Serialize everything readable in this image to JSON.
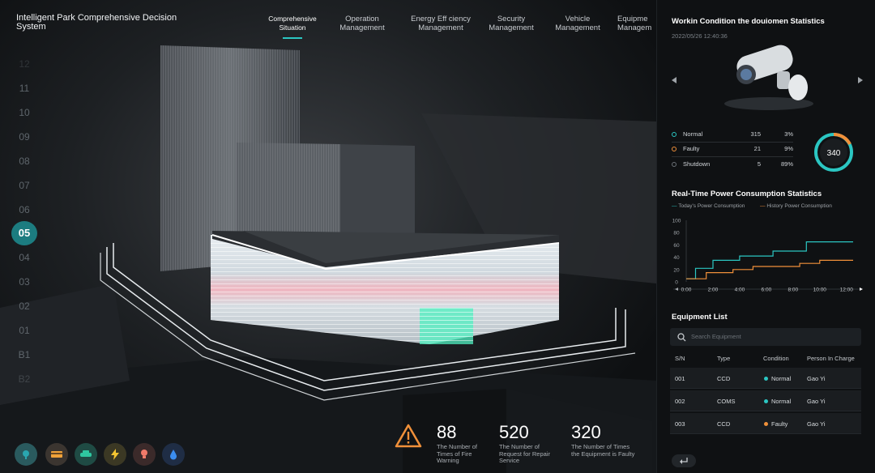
{
  "brand": "Intelligent Park Comprehensive Decision System",
  "nav": [
    {
      "label": "Comprehensive\nSituation",
      "active": true
    },
    {
      "label": "Operation\nManagement"
    },
    {
      "label": "Energy Eff ciency\nManagement"
    },
    {
      "label": "Security\nManagement"
    },
    {
      "label": "Vehicle\nManagement"
    },
    {
      "label": "Equipme\nManagem"
    }
  ],
  "floors": [
    "12",
    "11",
    "10",
    "09",
    "08",
    "07",
    "06",
    "05",
    "04",
    "03",
    "02",
    "01",
    "B1",
    "B2"
  ],
  "active_floor": "05",
  "tools": [
    {
      "icon": "location-pin-icon",
      "color": "#2aa7b0"
    },
    {
      "icon": "card-icon",
      "color": "#f0a23a"
    },
    {
      "icon": "car-icon",
      "color": "#2fc7a0"
    },
    {
      "icon": "lightning-icon",
      "color": "#f5c531"
    },
    {
      "icon": "bulb-icon",
      "color": "#f07a6a"
    },
    {
      "icon": "water-drop-icon",
      "color": "#3b8df0"
    }
  ],
  "stats": [
    {
      "value": "88",
      "label": "The Number of Times of Fire Warning"
    },
    {
      "value": "520",
      "label": "The Number of Request for Repair Service"
    },
    {
      "value": "320",
      "label": "The Number of Times the Equipment is Faulty"
    }
  ],
  "panel": {
    "work_title": "Workin Condition the douiomen Statistics",
    "datetime": "2022/05/26 12:40:36",
    "conditions": [
      {
        "name": "Normal",
        "count": "315",
        "pct": "3%",
        "color": "#2bc6c2"
      },
      {
        "name": "Faulty",
        "count": "21",
        "pct": "9%",
        "color": "#f0903a"
      },
      {
        "name": "Shutdown",
        "count": "5",
        "pct": "89%",
        "color": "#6b7177"
      }
    ],
    "total": "340",
    "power_title": "Real-Time Power Consumption Statistics",
    "today_label": "Today's Power Consumption",
    "history_label": "History Power Consumption",
    "equip_title": "Equipment List",
    "search_placeholder": "Search Equipment",
    "columns": [
      "S/N",
      "Type",
      "Condition",
      "Person In Charge"
    ],
    "rows": [
      {
        "sn": "001",
        "type": "CCD",
        "condition": "Normal",
        "person": "Gao Yi",
        "color": "#2bc6c2"
      },
      {
        "sn": "002",
        "type": "COMS",
        "condition": "Normal",
        "person": "Gao Yi",
        "color": "#2bc6c2"
      },
      {
        "sn": "003",
        "type": "CCD",
        "condition": "Faulty",
        "person": "Gao Yi",
        "color": "#f0903a"
      }
    ]
  },
  "chart_data": {
    "type": "line",
    "x": [
      "0:00",
      "2:00",
      "4:00",
      "6:00",
      "8:00",
      "10:00",
      "12:00"
    ],
    "ylim": [
      0,
      100
    ],
    "yticks": [
      "100",
      "80",
      "60",
      "40",
      "20",
      "0"
    ],
    "series": [
      {
        "name": "Today's Power Consumption",
        "color": "#2bc6c2",
        "points": [
          [
            0,
            5
          ],
          [
            0.7,
            5
          ],
          [
            0.7,
            22
          ],
          [
            2,
            22
          ],
          [
            2,
            35
          ],
          [
            4,
            35
          ],
          [
            4,
            42
          ],
          [
            6.5,
            42
          ],
          [
            6.5,
            50
          ],
          [
            9,
            50
          ],
          [
            9,
            65
          ],
          [
            12.5,
            65
          ]
        ]
      },
      {
        "name": "History Power Consumption",
        "color": "#f0903a",
        "points": [
          [
            0,
            5
          ],
          [
            1.5,
            5
          ],
          [
            1.5,
            15
          ],
          [
            3.5,
            15
          ],
          [
            3.5,
            20
          ],
          [
            5,
            20
          ],
          [
            5,
            25
          ],
          [
            8.5,
            25
          ],
          [
            8.5,
            30
          ],
          [
            10,
            30
          ],
          [
            10,
            35
          ],
          [
            12.5,
            35
          ]
        ]
      }
    ]
  }
}
